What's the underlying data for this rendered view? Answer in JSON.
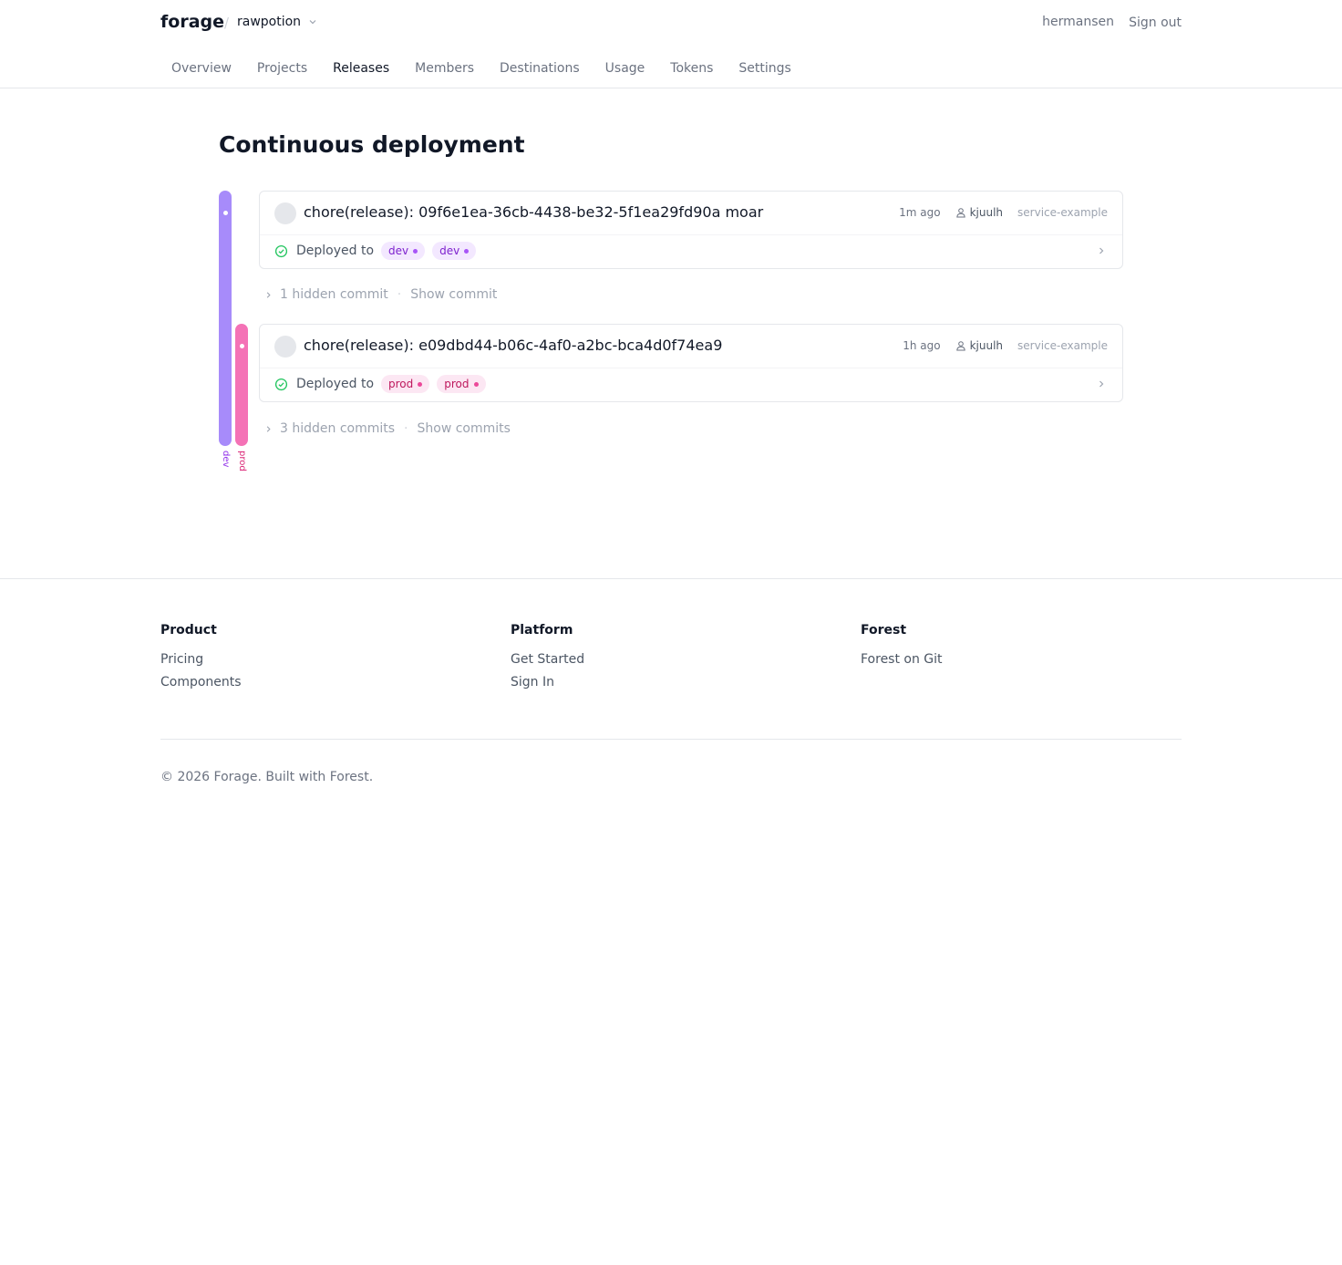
{
  "header": {
    "brand": "forage",
    "separator": "/",
    "org": "rawpotion",
    "username": "hermansen",
    "sign_out": "Sign out"
  },
  "nav": {
    "items": [
      "Overview",
      "Projects",
      "Releases",
      "Members",
      "Destinations",
      "Usage",
      "Tokens",
      "Settings"
    ],
    "active": "Releases"
  },
  "page": {
    "title": "Continuous deployment"
  },
  "lanes": [
    {
      "label": "dev",
      "color": "#a78bfa",
      "label_color": "#9333ea"
    },
    {
      "label": "prod",
      "color": "#f472b6",
      "label_color": "#db2777"
    }
  ],
  "releases": [
    {
      "message": "chore(release): 09f6e1ea-36cb-4438-be32-5f1ea29fd90a moar",
      "ago": "1m ago",
      "author": "kjuulh",
      "service": "service-example",
      "deployed_label": "Deployed to",
      "badges": [
        "dev",
        "dev"
      ],
      "hidden_text": "1 hidden commit",
      "show_text": "Show commit"
    },
    {
      "message": "chore(release): e09dbd44-b06c-4af0-a2bc-bca4d0f74ea9",
      "ago": "1h ago",
      "author": "kjuulh",
      "service": "service-example",
      "deployed_label": "Deployed to",
      "badges": [
        "prod",
        "prod"
      ],
      "hidden_text": "3 hidden commits",
      "show_text": "Show commits"
    }
  ],
  "footer": {
    "columns": [
      {
        "title": "Product",
        "links": [
          "Pricing",
          "Components"
        ]
      },
      {
        "title": "Platform",
        "links": [
          "Get Started",
          "Sign In"
        ]
      },
      {
        "title": "Forest",
        "links": [
          "Forest on Git"
        ]
      }
    ],
    "copyright": "© 2026 Forage. Built with Forest."
  }
}
